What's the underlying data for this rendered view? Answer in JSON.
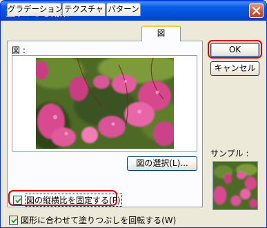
{
  "window": {
    "title": "塗りつぶし効果"
  },
  "tabs": [
    {
      "label": "グラデーション",
      "active": false
    },
    {
      "label": "テクスチャ",
      "active": false
    },
    {
      "label": "パターン",
      "active": false
    },
    {
      "label": "図",
      "active": true
    }
  ],
  "panel": {
    "figure_label": "図 :",
    "select_picture_button": "図の選択(L)...",
    "lock_aspect_checkbox": {
      "label": "図の縦横比を固定する(P)",
      "checked": true
    }
  },
  "footer": {
    "rotate_checkbox": {
      "label": "図形に合わせて塗りつぶしを回転する(W)",
      "checked": true
    }
  },
  "buttons": {
    "ok": "OK",
    "cancel": "キャンセル"
  },
  "sample": {
    "label": "サンプル :"
  },
  "colors": {
    "title_bar": "#0a5de8",
    "highlight_ring": "#e00000",
    "tab_active_accent": "#ffc83c"
  }
}
